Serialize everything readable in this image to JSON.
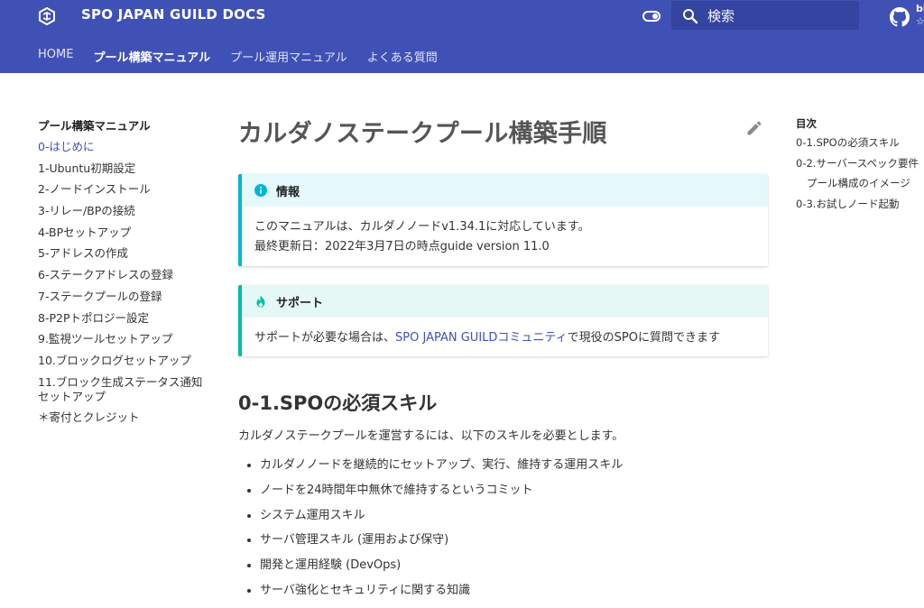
{
  "header": {
    "site_title": "SPO JAPAN GUILD DOCS",
    "search_placeholder": "検索",
    "repo_text": "bl",
    "repo_star": "☆",
    "accent": "#4051b5"
  },
  "tabs": [
    {
      "label": "HOME"
    },
    {
      "label": "プール構築マニュアル"
    },
    {
      "label": "プール運用マニュアル"
    },
    {
      "label": "よくある質問"
    }
  ],
  "sidebar": {
    "title": "プール構築マニュアル",
    "items": [
      {
        "label": "0-はじめに"
      },
      {
        "label": "1-Ubuntu初期設定"
      },
      {
        "label": "2-ノードインストール"
      },
      {
        "label": "3-リレー/BPの接続"
      },
      {
        "label": "4-BPセットアップ"
      },
      {
        "label": "5-アドレスの作成"
      },
      {
        "label": "6-ステークアドレスの登録"
      },
      {
        "label": "7-ステークプールの登録"
      },
      {
        "label": "8-P2Pトポロジー設定"
      },
      {
        "label": "9.監視ツールセットアップ"
      },
      {
        "label": "10.ブロックログセットアップ"
      },
      {
        "label": "11.ブロック生成ステータス通知セットアップ"
      },
      {
        "label": "＊寄付とクレジット"
      }
    ]
  },
  "main": {
    "title": "カルダノステークプール構築手順",
    "info": {
      "label": "情報",
      "line1": "このマニュアルは、カルダノノードv1.34.1に対応しています。",
      "line2": "最終更新日：2022年3月7日の時点guide version 11.0"
    },
    "support": {
      "label": "サポート",
      "before": "サポートが必要な場合は、",
      "link": "SPO JAPAN GUILDコミュニティ",
      "after": "で現役のSPOに質問できます"
    },
    "section_title": "0-1.SPOの必須スキル",
    "section_intro": "カルダノステークプールを運営するには、以下のスキルを必要とします。",
    "skills": [
      "カルダノノードを継続的にセットアップ、実行、維持する運用スキル",
      "ノードを24時間年中無休で維持するというコミット",
      "システム運用スキル",
      "サーバ管理スキル (運用および保守)",
      "開発と運用経験 (DevOps)",
      "サーバ強化とセキュリティに関する知識"
    ]
  },
  "toc": {
    "title": "目次",
    "items": [
      {
        "label": "0-1.SPOの必須スキル"
      },
      {
        "label": "0-2.サーバースペック要件"
      },
      {
        "label": "プール構成のイメージ"
      },
      {
        "label": "0-3.お試しノード起動"
      }
    ]
  }
}
